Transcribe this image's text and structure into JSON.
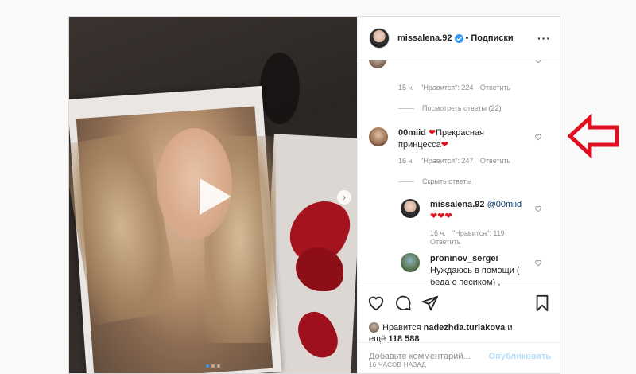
{
  "header": {
    "username": "missalena.92",
    "separator": "•",
    "follow_label": "Подписки",
    "more_icon": "more-horizontal-icon"
  },
  "comments": {
    "top_comment_meta": {
      "time": "15 ч.",
      "likes": "\"Нравится\": 224",
      "reply": "Ответить"
    },
    "view_replies": "Посмотреть ответы (22)",
    "comment2": {
      "username": "00miid",
      "text_line1": "Прекрасная",
      "text_line2": "принцесса",
      "meta": {
        "time": "16 ч.",
        "likes": "\"Нравится\": 247",
        "reply": "Ответить"
      },
      "hide_replies": "Скрыть ответы"
    },
    "reply1": {
      "username": "missalena.92",
      "mention": "@00miid",
      "meta": {
        "time": "16 ч.",
        "likes": "\"Нравится\": 119",
        "reply": "Ответить"
      }
    },
    "reply2": {
      "username": "proninov_sergei",
      "text_line1": "Нуждаюсь в помощи (",
      "text_line2": "беда с песиком) ,"
    }
  },
  "actions": {
    "likes_prefix": "Нравится",
    "likes_user": "nadezhda.turlakova",
    "likes_suffix": "и",
    "likes_more_prefix": "ещё",
    "likes_count": "118 588",
    "timestamp": "16 ЧАСОВ НАЗАД",
    "comment_placeholder": "Добавьте комментарий...",
    "publish_label": "Опубликовать"
  },
  "colors": {
    "accent": "#3897f0",
    "heart": "#e0141e",
    "arrow": "#e01020"
  }
}
